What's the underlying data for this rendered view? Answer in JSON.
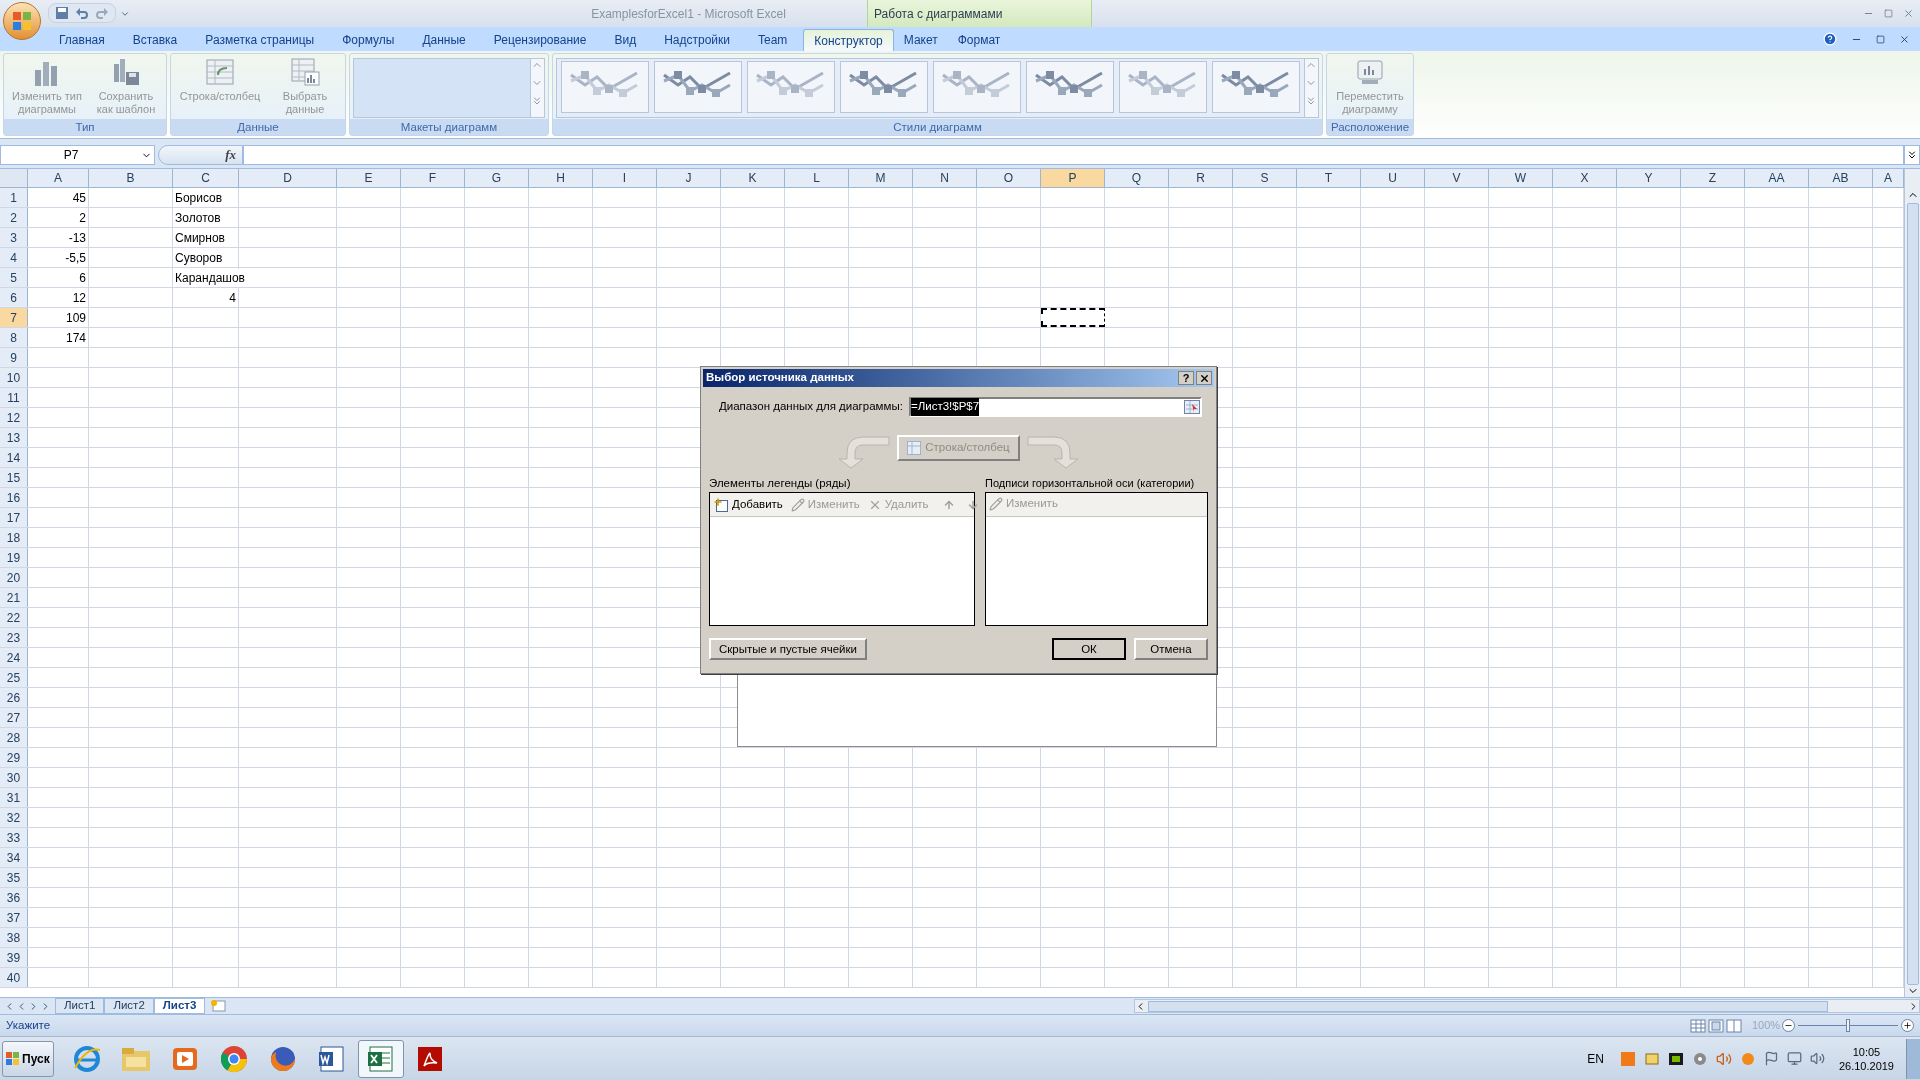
{
  "window": {
    "title": "ExamplesforExcel1 - Microsoft Excel",
    "contextual_group": "Работа с диаграммами"
  },
  "ribbon_tabs": [
    {
      "label": "Главная",
      "selected": false
    },
    {
      "label": "Вставка",
      "selected": false
    },
    {
      "label": "Разметка страницы",
      "selected": false
    },
    {
      "label": "Формулы",
      "selected": false
    },
    {
      "label": "Данные",
      "selected": false
    },
    {
      "label": "Рецензирование",
      "selected": false
    },
    {
      "label": "Вид",
      "selected": false
    },
    {
      "label": "Надстройки",
      "selected": false
    },
    {
      "label": "Team",
      "selected": false
    }
  ],
  "contextual_tabs": [
    {
      "label": "Конструктор",
      "selected": true
    },
    {
      "label": "Макет",
      "selected": false
    },
    {
      "label": "Формат",
      "selected": false
    }
  ],
  "ribbon_groups": [
    {
      "label": "Тип",
      "kind": "buttons",
      "buttons": [
        {
          "label": "Изменить тип диаграммы",
          "kind": "chart",
          "disabled": true
        },
        {
          "label": "Сохранить как шаблон",
          "kind": "template",
          "disabled": true
        }
      ]
    },
    {
      "label": "Данные",
      "kind": "buttons",
      "buttons": [
        {
          "label": "Строка/столбец",
          "kind": "swap",
          "disabled": true
        },
        {
          "label": "Выбрать данные",
          "kind": "select",
          "disabled": true
        }
      ]
    },
    {
      "label": "Макеты диаграмм",
      "kind": "layouts"
    },
    {
      "label": "Стили диаграмм",
      "kind": "styles"
    },
    {
      "label": "Расположение",
      "kind": "buttons",
      "buttons": [
        {
          "label": "Переместить диаграмму",
          "kind": "move",
          "disabled": true
        }
      ]
    }
  ],
  "formula_bar": {
    "name_box": "P7",
    "fx": "fx"
  },
  "sheet": {
    "columns": [
      {
        "label": "A",
        "selected": false
      },
      {
        "label": "B",
        "selected": false
      },
      {
        "label": "C",
        "selected": false
      },
      {
        "label": "D",
        "selected": false
      },
      {
        "label": "E",
        "selected": false
      },
      {
        "label": "F",
        "selected": false
      },
      {
        "label": "G",
        "selected": false
      },
      {
        "label": "H",
        "selected": false
      },
      {
        "label": "I",
        "selected": false
      },
      {
        "label": "J",
        "selected": false
      },
      {
        "label": "K",
        "selected": false
      },
      {
        "label": "L",
        "selected": false
      },
      {
        "label": "M",
        "selected": false
      },
      {
        "label": "N",
        "selected": false
      },
      {
        "label": "O",
        "selected": false
      },
      {
        "label": "P",
        "selected": true
      },
      {
        "label": "Q",
        "selected": false
      },
      {
        "label": "R",
        "selected": false
      },
      {
        "label": "S",
        "selected": false
      },
      {
        "label": "T",
        "selected": false
      },
      {
        "label": "U",
        "selected": false
      },
      {
        "label": "V",
        "selected": false
      },
      {
        "label": "W",
        "selected": false
      },
      {
        "label": "X",
        "selected": false
      },
      {
        "label": "Y",
        "selected": false
      },
      {
        "label": "Z",
        "selected": false
      },
      {
        "label": "AA",
        "selected": false
      },
      {
        "label": "AB",
        "selected": false
      },
      {
        "label": "A",
        "selected": false
      }
    ],
    "rows": [
      {
        "label": "1",
        "selected": false,
        "cells": [
          {
            "kind": "number",
            "value": "45"
          },
          {
            "kind": "empty"
          },
          {
            "kind": "text",
            "value": "Борисов"
          }
        ]
      },
      {
        "label": "2",
        "selected": false,
        "cells": [
          {
            "kind": "number",
            "value": "2"
          },
          {
            "kind": "empty"
          },
          {
            "kind": "text",
            "value": "Золотов"
          }
        ]
      },
      {
        "label": "3",
        "selected": false,
        "cells": [
          {
            "kind": "number",
            "value": "-13"
          },
          {
            "kind": "empty"
          },
          {
            "kind": "text",
            "value": "Смирнов"
          }
        ]
      },
      {
        "label": "4",
        "selected": false,
        "cells": [
          {
            "kind": "number",
            "value": "-5,5"
          },
          {
            "kind": "empty"
          },
          {
            "kind": "text",
            "value": "Суворов"
          }
        ]
      },
      {
        "label": "5",
        "selected": false,
        "cells": [
          {
            "kind": "number",
            "value": "6"
          },
          {
            "kind": "empty"
          },
          {
            "kind": "text",
            "value": "Карандашов"
          }
        ]
      },
      {
        "label": "6",
        "selected": false,
        "cells": [
          {
            "kind": "number",
            "value": "12"
          },
          {
            "kind": "empty"
          },
          {
            "kind": "number",
            "value": "4"
          }
        ]
      },
      {
        "label": "7",
        "selected": true,
        "cells": [
          {
            "kind": "number",
            "value": "109"
          }
        ]
      },
      {
        "label": "8",
        "selected": false,
        "cells": [
          {
            "kind": "number",
            "value": "174"
          }
        ]
      },
      {
        "label": "9",
        "selected": false
      },
      {
        "label": "10",
        "selected": false
      },
      {
        "label": "11",
        "selected": false
      },
      {
        "label": "12",
        "selected": false
      },
      {
        "label": "13",
        "selected": false
      },
      {
        "label": "14",
        "selected": false
      },
      {
        "label": "15",
        "selected": false
      },
      {
        "label": "16",
        "selected": false
      },
      {
        "label": "17",
        "selected": false
      },
      {
        "label": "18",
        "selected": false
      },
      {
        "label": "19",
        "selected": false
      },
      {
        "label": "20",
        "selected": false
      },
      {
        "label": "21",
        "selected": false
      },
      {
        "label": "22",
        "selected": false
      },
      {
        "label": "23",
        "selected": false
      },
      {
        "label": "24",
        "selected": false
      },
      {
        "label": "25",
        "selected": false
      },
      {
        "label": "26",
        "selected": false
      },
      {
        "label": "27",
        "selected": false
      },
      {
        "label": "28",
        "selected": false
      },
      {
        "label": "29",
        "selected": false
      },
      {
        "label": "30",
        "selected": false
      },
      {
        "label": "31",
        "selected": false
      },
      {
        "label": "32",
        "selected": false
      },
      {
        "label": "33",
        "selected": false
      },
      {
        "label": "34",
        "selected": false
      },
      {
        "label": "35",
        "selected": false
      },
      {
        "label": "36",
        "selected": false
      },
      {
        "label": "37",
        "selected": false
      },
      {
        "label": "38",
        "selected": false
      },
      {
        "label": "39",
        "selected": false
      },
      {
        "label": "40",
        "selected": false
      }
    ]
  },
  "sheet_tabs": [
    {
      "label": "Лист1",
      "selected": false
    },
    {
      "label": "Лист2",
      "selected": false
    },
    {
      "label": "Лист3",
      "selected": true
    }
  ],
  "dialog": {
    "title": "Выбор источника данных",
    "help": "?",
    "range_label": "Диапазон данных для диаграммы:",
    "range_value": "=Лист3!$P$7",
    "switch_button": {
      "label": "Строка/столбец",
      "disabled": true
    },
    "series_label": "Элементы легенды (ряды)",
    "series_tools": [
      {
        "label": "Добавить",
        "kind": "add",
        "disabled": false
      },
      {
        "label": "Изменить",
        "kind": "edit",
        "disabled": true
      },
      {
        "label": "Удалить",
        "kind": "delete",
        "disabled": true
      },
      {
        "kind": "up",
        "disabled": true
      },
      {
        "kind": "down",
        "disabled": true
      }
    ],
    "axis_label": "Подписи горизонтальной оси (категории)",
    "axis_tools": [
      {
        "label": "Изменить",
        "kind": "edit",
        "disabled": true
      }
    ],
    "buttons": [
      {
        "label": "Скрытые и пустые ячейки",
        "kind": "left"
      },
      {
        "label": "ОК",
        "kind": "default"
      },
      {
        "label": "Отмена",
        "kind": "normal"
      }
    ]
  },
  "status_bar": {
    "mode": "Укажите",
    "zoom": "100%",
    "zoom_level": {
      "level": 0.5
    }
  },
  "taskbar": {
    "start": "Пуск",
    "apps": [
      {
        "kind": "globe",
        "selected": false
      },
      {
        "kind": "folder",
        "selected": false
      },
      {
        "kind": "player",
        "selected": false
      },
      {
        "kind": "chrome",
        "selected": false
      },
      {
        "kind": "fox",
        "selected": false
      },
      {
        "kind": "word",
        "selected": false
      },
      {
        "kind": "excel",
        "selected": true
      },
      {
        "kind": "pdf",
        "selected": false
      }
    ],
    "language": "EN",
    "time": "10:05",
    "date": "26.10.2019"
  }
}
